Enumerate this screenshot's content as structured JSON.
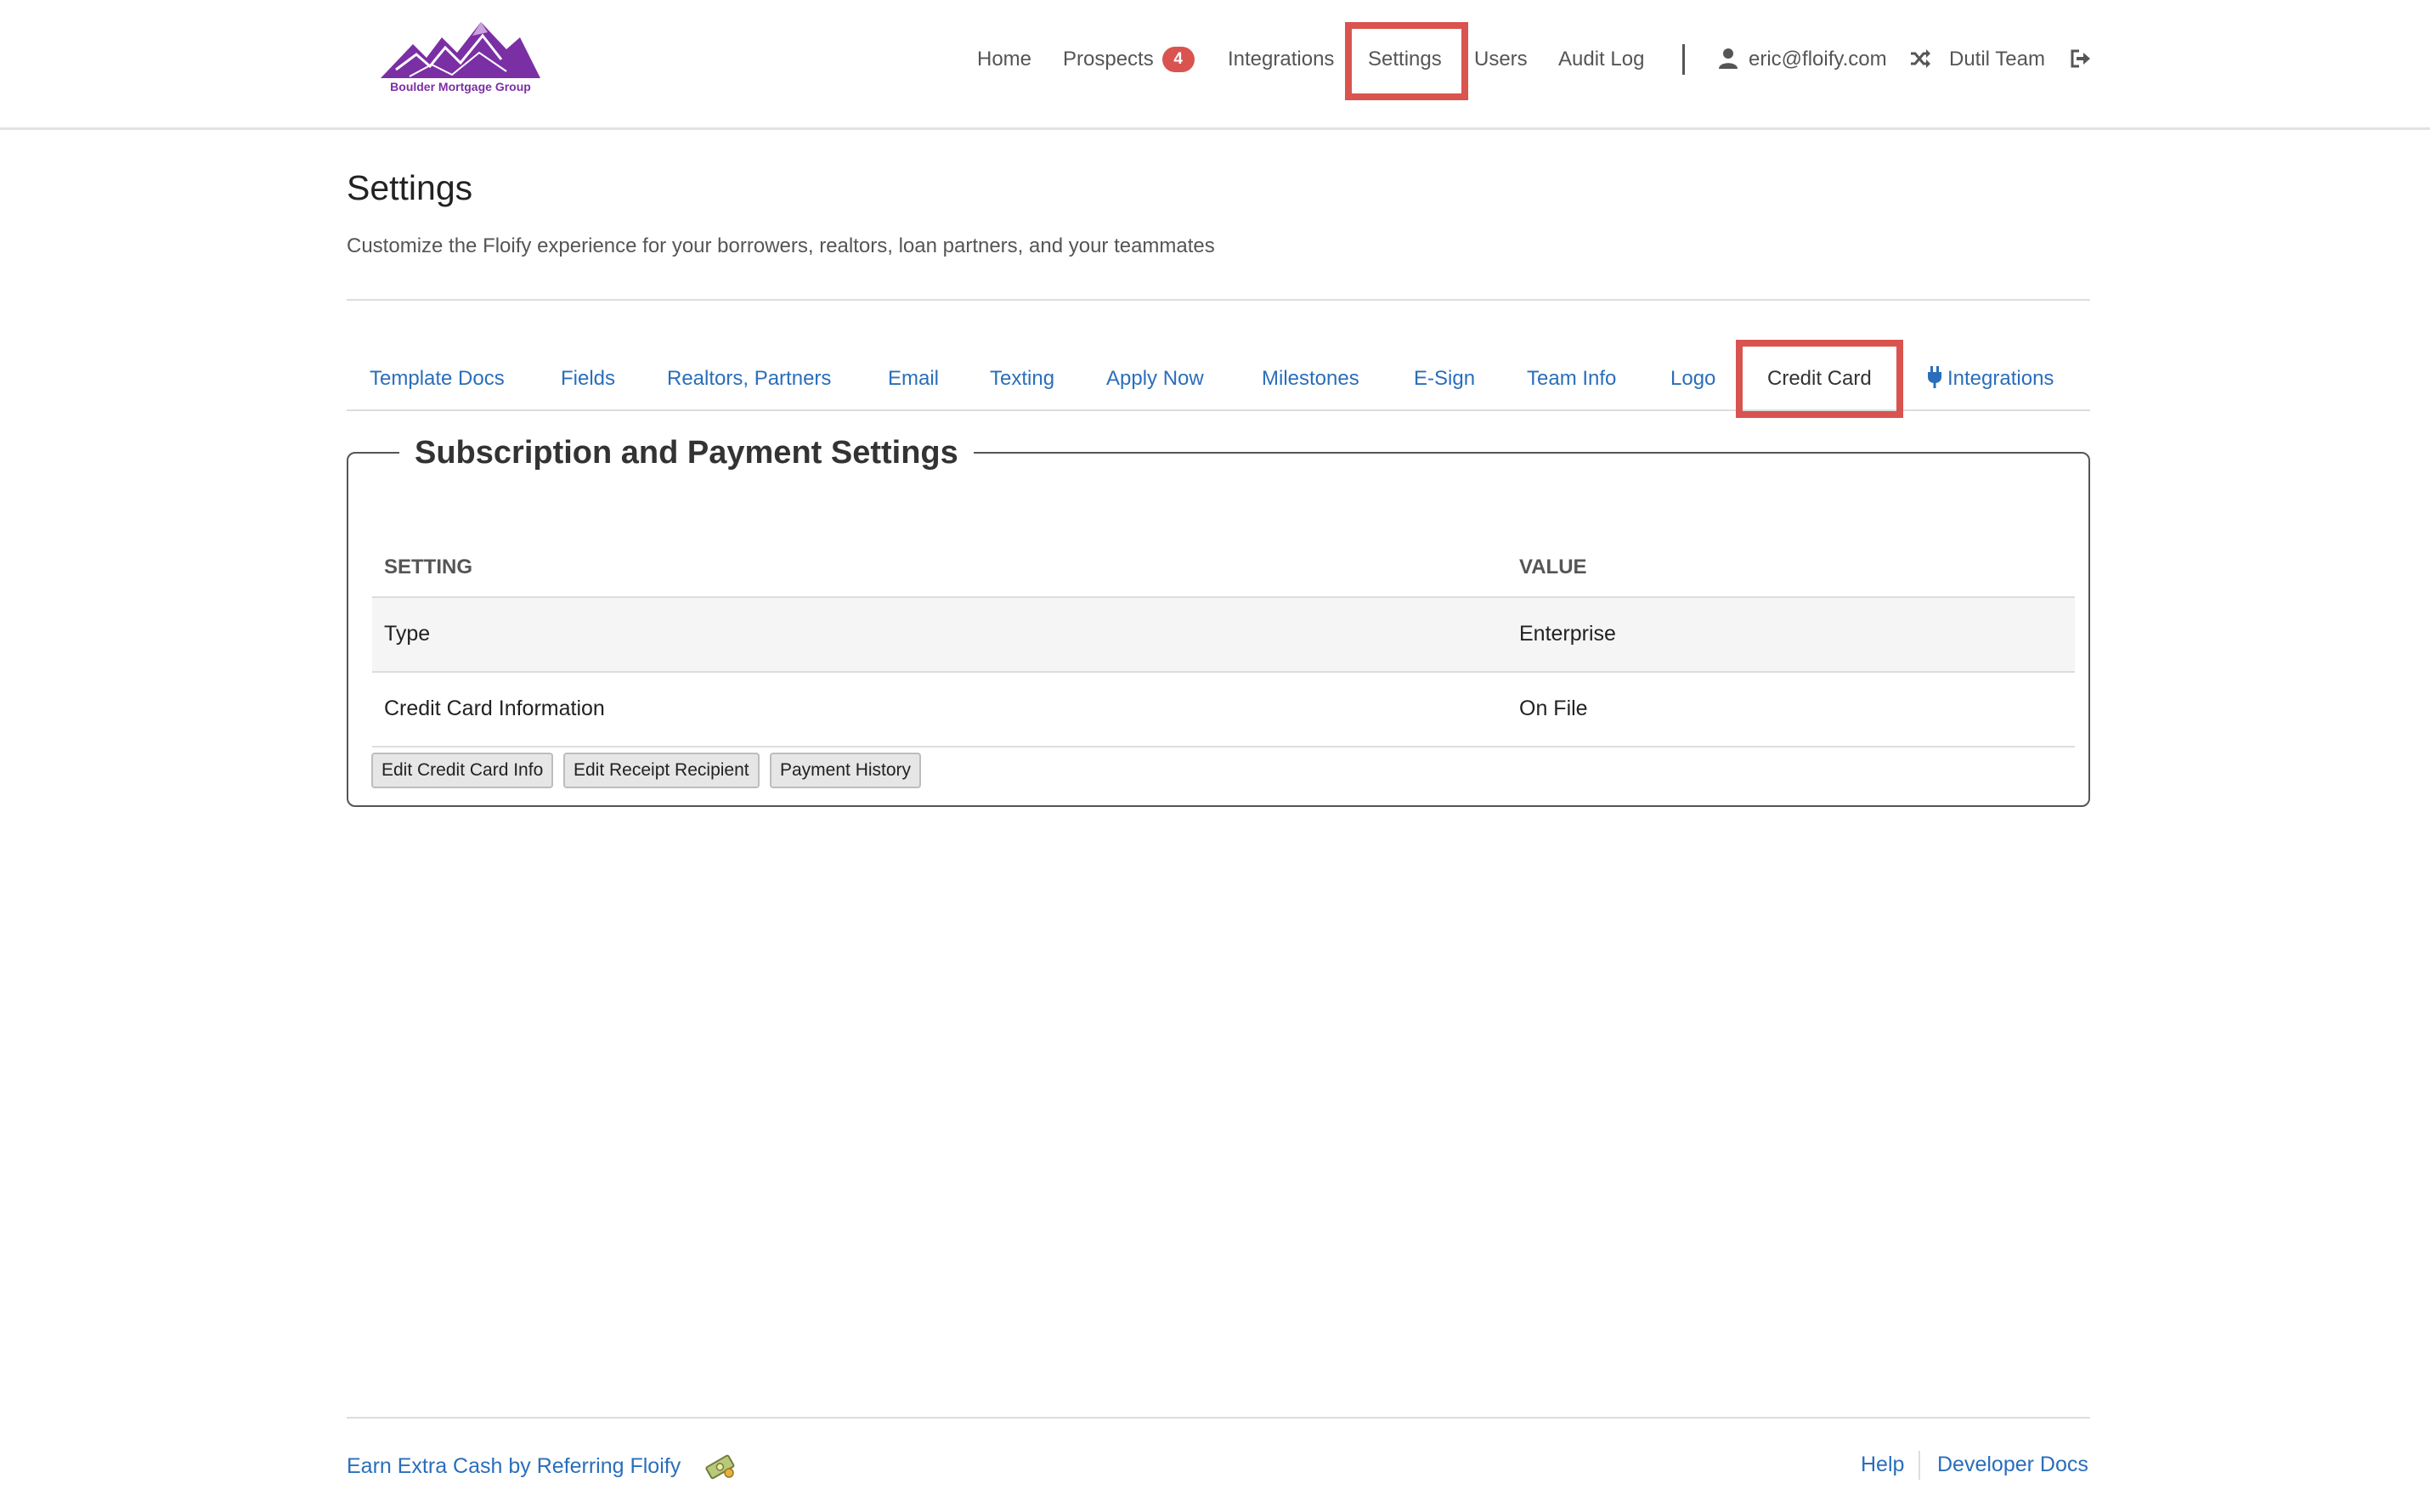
{
  "brand": {
    "logo_text": "Boulder Mortgage Group",
    "logo_color": "#7b2fa4"
  },
  "nav": {
    "home": "Home",
    "prospects": "Prospects",
    "prospects_badge": "4",
    "integrations": "Integrations",
    "settings": "Settings",
    "users": "Users",
    "audit_log": "Audit Log",
    "user_email": "eric@floify.com",
    "team": "Dutil Team",
    "icons": [
      "user-icon",
      "shuffle-icon",
      "logout-icon"
    ]
  },
  "page": {
    "title": "Settings",
    "subtitle": "Customize the Floify experience for your borrowers, realtors, loan partners, and your teammates"
  },
  "tabs": [
    {
      "label": "Template Docs"
    },
    {
      "label": "Fields"
    },
    {
      "label": "Realtors, Partners"
    },
    {
      "label": "Email"
    },
    {
      "label": "Texting"
    },
    {
      "label": "Apply Now"
    },
    {
      "label": "Milestones"
    },
    {
      "label": "E-Sign"
    },
    {
      "label": "Team Info"
    },
    {
      "label": "Logo"
    },
    {
      "label": "Credit Card",
      "active": true
    },
    {
      "label": "Integrations",
      "icon": "plug-icon"
    }
  ],
  "panel": {
    "legend": "Subscription and Payment Settings",
    "headers": {
      "setting": "SETTING",
      "value": "VALUE"
    },
    "rows": [
      {
        "setting": "Type",
        "value": "Enterprise"
      },
      {
        "setting": "Credit Card Information",
        "value": "On File"
      }
    ],
    "buttons": {
      "edit_card": "Edit Credit Card Info",
      "edit_receipt": "Edit Receipt Recipient",
      "payment_history": "Payment History"
    }
  },
  "footer": {
    "referral": "Earn Extra Cash by Referring Floify",
    "help": "Help",
    "developer_docs": "Developer Docs"
  },
  "colors": {
    "link": "#2a6ebb",
    "highlight": "#d9534f",
    "badge": "#d9534f"
  }
}
